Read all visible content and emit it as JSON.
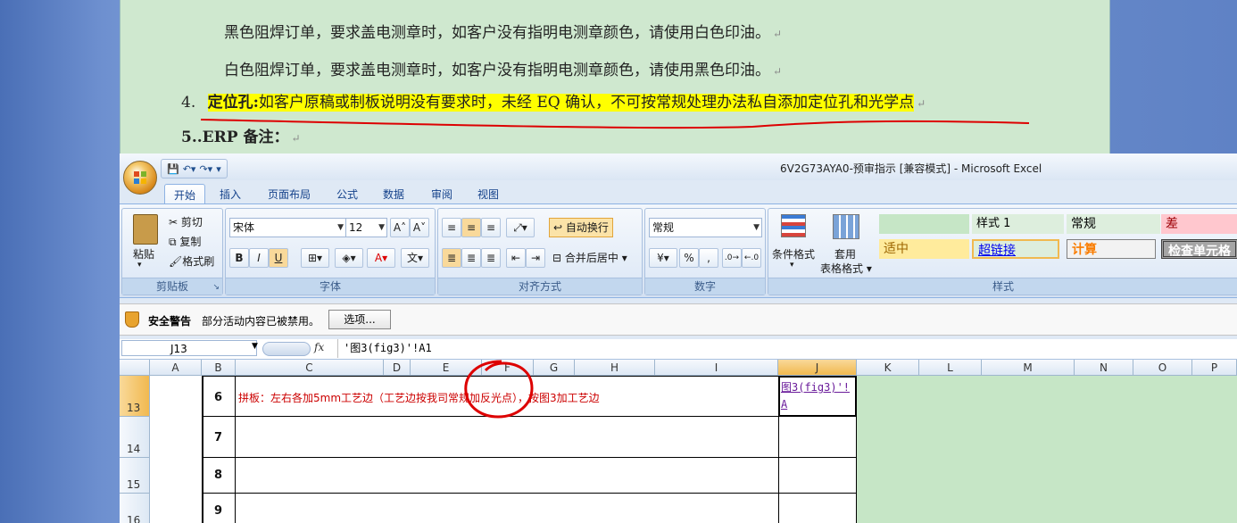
{
  "doc": {
    "line1": "黑色阻焊订单，要求盖电测章时，如客户没有指明电测章颜色，请使用白色印油。",
    "line2": "白色阻焊订单，要求盖电测章时，如客户没有指明电测章颜色，请使用黑色印油。",
    "item4_num": "4.",
    "item4_label": "定位孔:",
    "item4_text": "如客户原稿或制板说明没有要求时，未经 EQ 确认，不可按常规处理办法私自添加定位孔和光学点",
    "item5_num": "5.",
    "item5_text": ".ERP 备注：",
    "para_mark": "↵"
  },
  "excel": {
    "window_title": "6V2G73AYA0-预审指示  [兼容模式] - Microsoft Excel",
    "tabs": [
      "开始",
      "插入",
      "页面布局",
      "公式",
      "数据",
      "审阅",
      "视图"
    ],
    "clipboard": {
      "paste": "粘贴",
      "cut": "剪切",
      "copy": "复制",
      "format_painter": "格式刷",
      "label": "剪贴板"
    },
    "font": {
      "name": "宋体",
      "size": "12",
      "bold": "B",
      "italic": "I",
      "underline": "U",
      "label": "字体"
    },
    "alignment": {
      "wrap": "自动换行",
      "merge": "合并后居中",
      "label": "对齐方式"
    },
    "number": {
      "format": "常规",
      "percent": "%",
      "comma": ",",
      "label": "数字"
    },
    "styles": {
      "cond": "条件格式",
      "table_fmt_1": "套用",
      "table_fmt_2": "表格格式",
      "cells": [
        "",
        "样式 1",
        "常规",
        "差",
        "适中",
        "超链接",
        "计算",
        "检查单元格"
      ],
      "label": "样式"
    },
    "security": {
      "title": "安全警告",
      "message": "部分活动内容已被禁用。",
      "options": "选项..."
    },
    "namebox": "J13",
    "fx": "fx",
    "formula": "'图3(fig3)'!A1",
    "columns": [
      "A",
      "B",
      "C",
      "D",
      "E",
      "F",
      "G",
      "H",
      "I",
      "J",
      "K",
      "L",
      "M",
      "N",
      "O",
      "P"
    ],
    "rows": [
      "13",
      "14",
      "15",
      "16"
    ],
    "cells": {
      "b13": "6",
      "c13": "拼板：左右各加5mm工艺边（工艺边按我司常规加反光点），按图3加工艺边",
      "j13": "图3(fig3)'!A",
      "b14": "7",
      "b15": "8",
      "b16": "9"
    },
    "colors": {
      "red_text": "#cc0000",
      "link": "#6a1b9a",
      "annot": "#dd0000"
    }
  }
}
